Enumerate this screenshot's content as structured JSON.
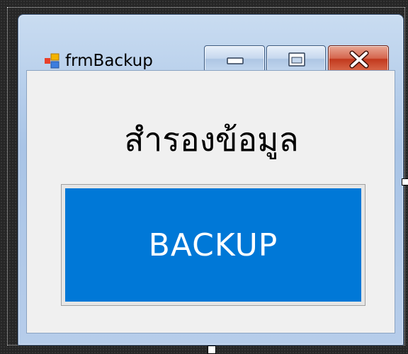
{
  "window": {
    "title": "frmBackup",
    "app_icon": "form-icon",
    "controls": {
      "minimize_icon": "minimize-icon",
      "maximize_icon": "maximize-icon",
      "close_icon": "close-icon"
    }
  },
  "form": {
    "heading": "สำรองข้อมูล",
    "backup_button_label": "BACKUP"
  },
  "colors": {
    "button_bg": "#0078d7",
    "button_text": "#ffffff",
    "client_bg": "#f0f0f0",
    "close_button": "#c2391e"
  }
}
